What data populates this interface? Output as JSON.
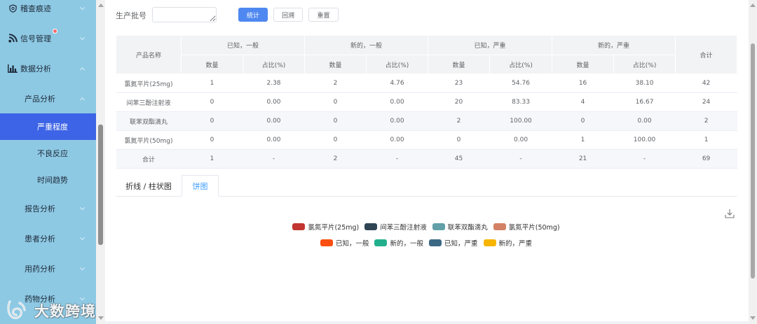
{
  "sidebar": {
    "background": "#8ec9e4",
    "active_color": "#3d64e6",
    "badge_color": "#f56c6c",
    "items": [
      {
        "label": "稽查痕迹",
        "icon": "shield-icon"
      },
      {
        "label": "信号管理",
        "icon": "rss-icon"
      },
      {
        "label": "数据分析",
        "icon": "bar-chart-icon"
      },
      {
        "label": "产品分析"
      },
      {
        "label": "严重程度"
      },
      {
        "label": "不良反应"
      },
      {
        "label": "时间趋势"
      },
      {
        "label": "报告分析"
      },
      {
        "label": "患者分析"
      },
      {
        "label": "用药分析"
      },
      {
        "label": "药物分析"
      }
    ]
  },
  "filter": {
    "batch_label": "生产批号",
    "stat_label": "统计",
    "trace_label": "回溯",
    "reset_label": "重置",
    "primary_color": "#4f88f0"
  },
  "table": {
    "product_header": "产品名称",
    "groups": [
      "已知，一般",
      "新的，一般",
      "已知，严重",
      "新的，严重"
    ],
    "count_header": "数量",
    "ratio_header": "占比(%)",
    "total_header": "合计",
    "rows": [
      {
        "name": "氯氮平片(25mg)",
        "values": [
          "1",
          "2.38",
          "2",
          "4.76",
          "23",
          "54.76",
          "16",
          "38.10",
          "42"
        ]
      },
      {
        "name": "间苯三酚注射液",
        "values": [
          "0",
          "0.00",
          "0",
          "0.00",
          "20",
          "83.33",
          "4",
          "16.67",
          "24"
        ]
      },
      {
        "name": "联苯双酯滴丸",
        "values": [
          "0",
          "0.00",
          "0",
          "0.00",
          "2",
          "100.00",
          "0",
          "0.00",
          "2"
        ]
      },
      {
        "name": "氯氮平片(50mg)",
        "values": [
          "0",
          "0.00",
          "0",
          "0.00",
          "0",
          "0.00",
          "1",
          "100.00",
          "1"
        ]
      },
      {
        "name": "合计",
        "values": [
          "1",
          "-",
          "2",
          "-",
          "45",
          "-",
          "21",
          "-",
          "69"
        ]
      }
    ]
  },
  "tabs": [
    {
      "label": "折线 / 柱状图"
    },
    {
      "label": "饼图"
    }
  ],
  "pie_legend": {
    "products": [
      {
        "label": "氯氮平片(25mg)",
        "color": "#c23531"
      },
      {
        "label": "间苯三酚注射液",
        "color": "#2f4554"
      },
      {
        "label": "联苯双酯滴丸",
        "color": "#61a0a8"
      },
      {
        "label": "氯氮平片(50mg)",
        "color": "#d48265"
      }
    ],
    "categories": [
      {
        "label": "已知，一般",
        "color": "#fb4e0f"
      },
      {
        "label": "新的，一般",
        "color": "#22b08c"
      },
      {
        "label": "已知，严重",
        "color": "#3c6886"
      },
      {
        "label": "新的，严重",
        "color": "#f7b500"
      }
    ]
  },
  "watermark": "大数跨境"
}
